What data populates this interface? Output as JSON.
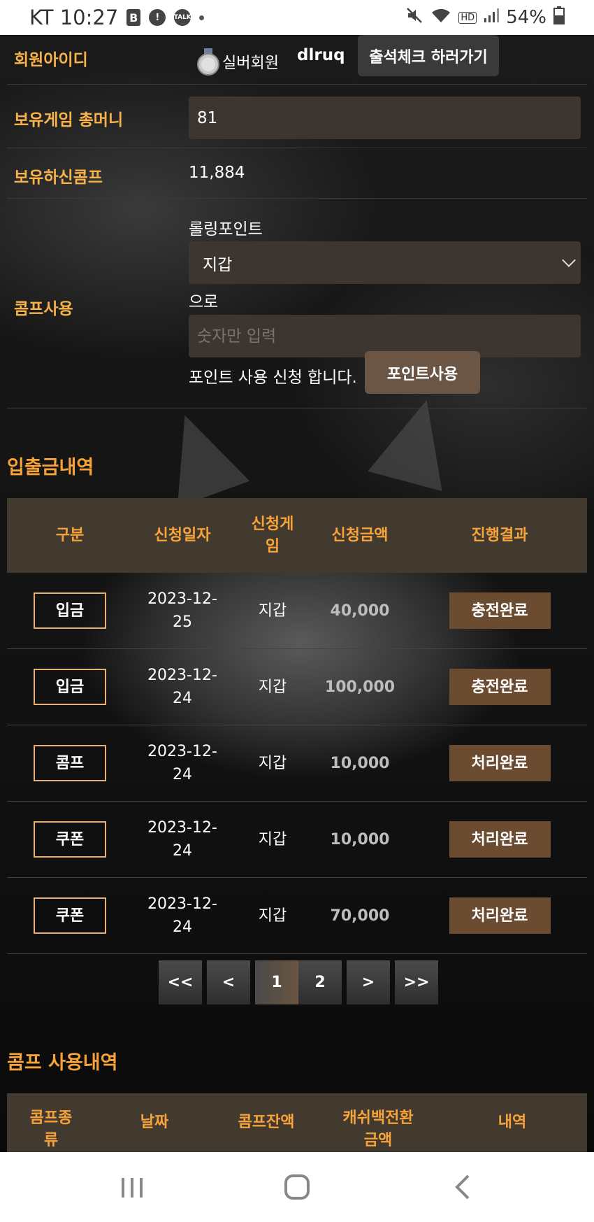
{
  "status_bar": {
    "carrier_time": "KT 10:27",
    "notif_b": "B",
    "notif_alert": "!",
    "notif_talk": "TALK",
    "battery": "54%"
  },
  "member": {
    "id_label": "회원아이디",
    "grade": "실버회원",
    "user_id": "dlruq",
    "attendance_button": "출석체크 하러가기",
    "money_label": "보유게임 총머니",
    "money_value": "81",
    "comp_label": "보유하신콤프",
    "comp_value": "11,884"
  },
  "comp_use": {
    "label": "콤프사용",
    "rolling_label": "롤링포인트",
    "wallet_select": "지갑",
    "to_text": "으로",
    "amount_placeholder": "숫자만 입력",
    "request_text": "포인트 사용 신청 합니다.",
    "use_button": "포인트사용"
  },
  "transactions": {
    "title": "입출금내역",
    "headers": [
      "구분",
      "신청일자",
      "신청게\n임",
      "신청금액",
      "진행결과"
    ],
    "rows": [
      {
        "type": "입금",
        "date": "2023-12-\n25",
        "game": "지갑",
        "amount": "40,000",
        "result": "충전완료"
      },
      {
        "type": "입금",
        "date": "2023-12-\n24",
        "game": "지갑",
        "amount": "100,000",
        "result": "충전완료"
      },
      {
        "type": "콤프",
        "date": "2023-12-\n24",
        "game": "지갑",
        "amount": "10,000",
        "result": "처리완료"
      },
      {
        "type": "쿠폰",
        "date": "2023-12-\n24",
        "game": "지갑",
        "amount": "10,000",
        "result": "처리완료"
      },
      {
        "type": "쿠폰",
        "date": "2023-12-\n24",
        "game": "지갑",
        "amount": "70,000",
        "result": "처리완료"
      }
    ]
  },
  "pagination": {
    "first": "<<",
    "prev": "<",
    "page1": "1",
    "page2": "2",
    "next": ">",
    "last": ">>"
  },
  "comp_history": {
    "title": "콤프 사용내역",
    "headers": [
      "콤프종\n류",
      "날짜",
      "콤프잔액",
      "캐쉬백전환\n금액",
      "내역"
    ]
  }
}
